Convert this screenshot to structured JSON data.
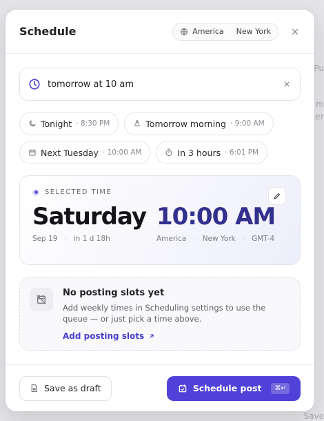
{
  "background": {
    "fragments": [
      "Pu",
      "nt m",
      "nter",
      "Save"
    ]
  },
  "header": {
    "title": "Schedule",
    "timezone_region": "America",
    "timezone_city": "New York",
    "icons": {
      "globe": "globe-icon",
      "close": "close-icon"
    }
  },
  "nl_input": {
    "value": "tomorrow at 10 am",
    "icons": {
      "clock": "clock-icon",
      "clear": "clear-icon"
    }
  },
  "presets": [
    {
      "label": "Tonight",
      "time": "· 8:30 PM",
      "icon": "moon-icon"
    },
    {
      "label": "Tomorrow morning",
      "time": "· 9:00 AM",
      "icon": "sunrise-icon"
    },
    {
      "label": "Next Tuesday",
      "time": "· 10:00 AM",
      "icon": "calendar-icon"
    },
    {
      "label": "In 3 hours",
      "time": "· 6:01 PM",
      "icon": "timer-icon"
    }
  ],
  "selected": {
    "label": "SELECTED TIME",
    "day": "Saturday",
    "time": "10:00 AM",
    "date": "Sep 19",
    "relative": "in 1 d 18h",
    "region": "America",
    "city": "New York",
    "offset": "GMT-4",
    "icons": {
      "edit": "pencil-icon"
    }
  },
  "slots": {
    "title": "No posting slots yet",
    "description": "Add weekly times in Scheduling settings to use the queue — or just pick a time above.",
    "link": "Add posting slots",
    "icons": {
      "empty": "calendar-off-icon",
      "link": "arrow-up-right-icon"
    }
  },
  "footer": {
    "draft_label": "Save as draft",
    "schedule_label": "Schedule post",
    "shortcut": "⌘↵"
  },
  "colors": {
    "accent": "#4f42d8",
    "time_text": "#33308e"
  }
}
